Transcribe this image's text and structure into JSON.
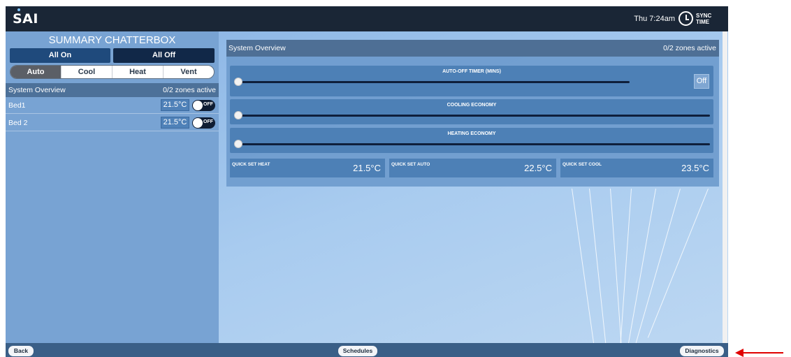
{
  "app": {
    "logo": "SAI"
  },
  "topbar": {
    "time": "Thu 7:24am",
    "sync_label": "SYNC TIME"
  },
  "left": {
    "title": "SUMMARY CHATTERBOX",
    "all_on": "All On",
    "all_off": "All Off",
    "modes": [
      {
        "label": "Auto",
        "active": true
      },
      {
        "label": "Cool",
        "active": false
      },
      {
        "label": "Heat",
        "active": false
      },
      {
        "label": "Vent",
        "active": false
      }
    ],
    "overview": {
      "label": "System Overview",
      "status": "0/2 zones active"
    },
    "zones": [
      {
        "name": "Bed1",
        "temp": "21.5°C",
        "toggle": "OFF"
      },
      {
        "name": "Bed 2",
        "temp": "21.5°C",
        "toggle": "OFF"
      }
    ]
  },
  "main": {
    "header": {
      "title": "System Overview",
      "status": "0/2 zones active"
    },
    "auto_off": {
      "title": "AUTO-OFF TIMER (MINS)",
      "value": 0,
      "button": "Off"
    },
    "cooling": {
      "title": "COOLING ECONOMY",
      "value": 0
    },
    "heating": {
      "title": "HEATING ECONOMY",
      "value": 0
    },
    "quick_set": [
      {
        "label": "QUICK SET HEAT",
        "value": "21.5°C"
      },
      {
        "label": "QUICK SET AUTO",
        "value": "22.5°C"
      },
      {
        "label": "QUICK SET COOL",
        "value": "23.5°C"
      }
    ]
  },
  "bottom": {
    "back": "Back",
    "schedules": "Schedules",
    "diagnostics": "Diagnostics"
  },
  "colors": {
    "topbar": "#1a2636",
    "accent": "#4d80b6",
    "annotation_arrow": "#e00000"
  }
}
